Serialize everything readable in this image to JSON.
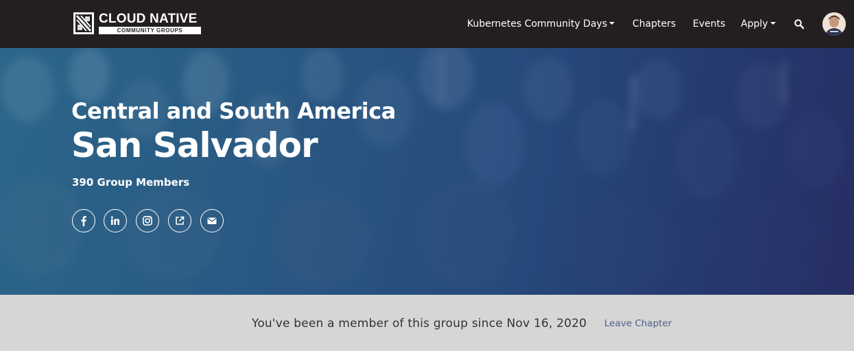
{
  "header": {
    "logo_title": "CLOUD NATIVE",
    "logo_subtitle": "COMMUNITY GROUPS",
    "nav": [
      {
        "label": "Kubernetes Community Days",
        "dropdown": true
      },
      {
        "label": "Chapters",
        "dropdown": false
      },
      {
        "label": "Events",
        "dropdown": false
      },
      {
        "label": "Apply",
        "dropdown": true
      }
    ],
    "icons": {
      "search": "search-icon",
      "avatar": "user-avatar"
    }
  },
  "hero": {
    "region": "Central and South America",
    "chapter_name": "San Salvador",
    "member_count": "390 Group Members",
    "social_links": [
      {
        "icon": "facebook-icon"
      },
      {
        "icon": "linkedin-icon"
      },
      {
        "icon": "instagram-icon"
      },
      {
        "icon": "external-link-icon"
      },
      {
        "icon": "email-icon"
      }
    ]
  },
  "membership": {
    "since_text": "You've been a member of this group since Nov 16, 2020",
    "leave_label": "Leave Chapter"
  },
  "colors": {
    "navbar": "#231f20",
    "hero_start": "#2f6a8d",
    "hero_end": "#2a3569",
    "strip": "#d6d6d6",
    "link": "#4d5f8c"
  }
}
